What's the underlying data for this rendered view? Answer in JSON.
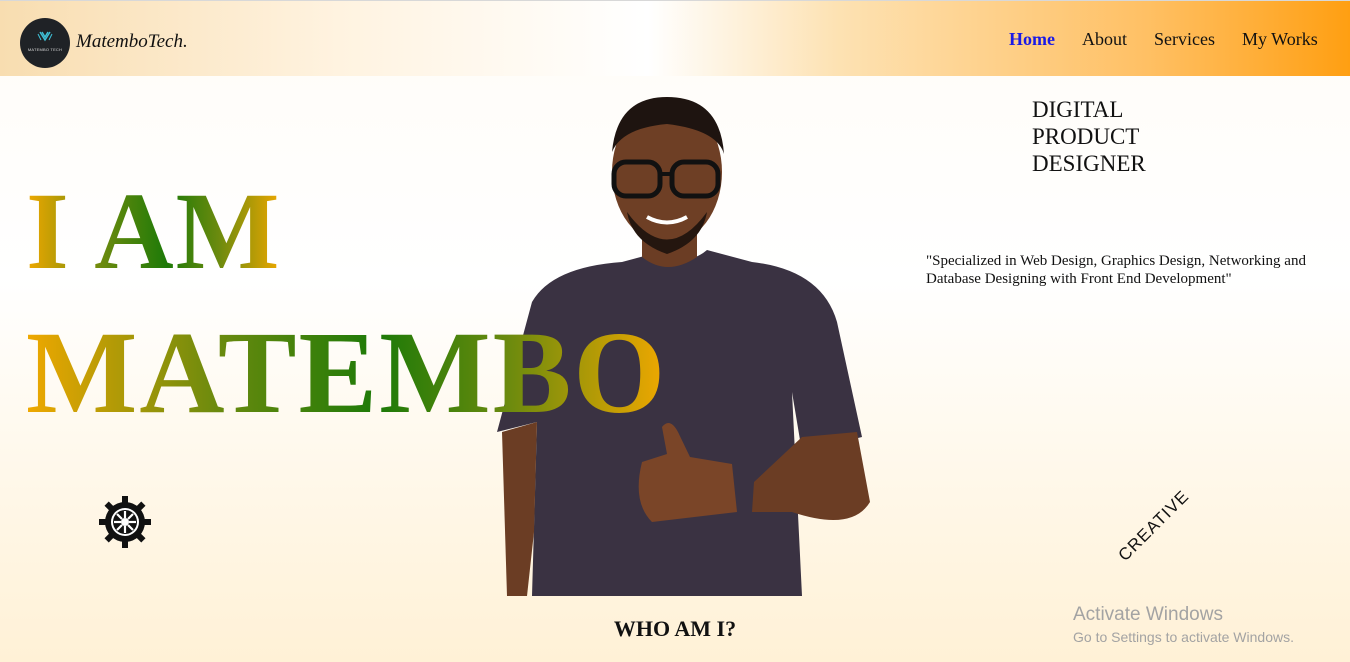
{
  "header": {
    "logo_text": "MATEMBO TECH",
    "brand": "MatemboTech.",
    "nav": [
      {
        "label": "Home",
        "active": true
      },
      {
        "label": "About",
        "active": false
      },
      {
        "label": "Services",
        "active": false
      },
      {
        "label": "My Works",
        "active": false
      }
    ]
  },
  "hero": {
    "line1": "I AM",
    "line2": "MATEMBO",
    "role": [
      "DIGITAL",
      "PRODUCT",
      "DESIGNER"
    ],
    "quote": "\"Specialized in Web Design, Graphics Design, Networking and Database Designing with Front End Development\"",
    "badge": "CREATIVE",
    "section_title": "WHO AM I?"
  },
  "watermark": {
    "title": "Activate Windows",
    "subtitle": "Go to Settings to activate Windows."
  },
  "colors": {
    "nav_active": "#1a1ae6",
    "header_end": "#ff9f12",
    "hero_gold": "#f0a800",
    "hero_green": "#1d7a08"
  },
  "icons": [
    "gear-icon",
    "logo-icon"
  ]
}
